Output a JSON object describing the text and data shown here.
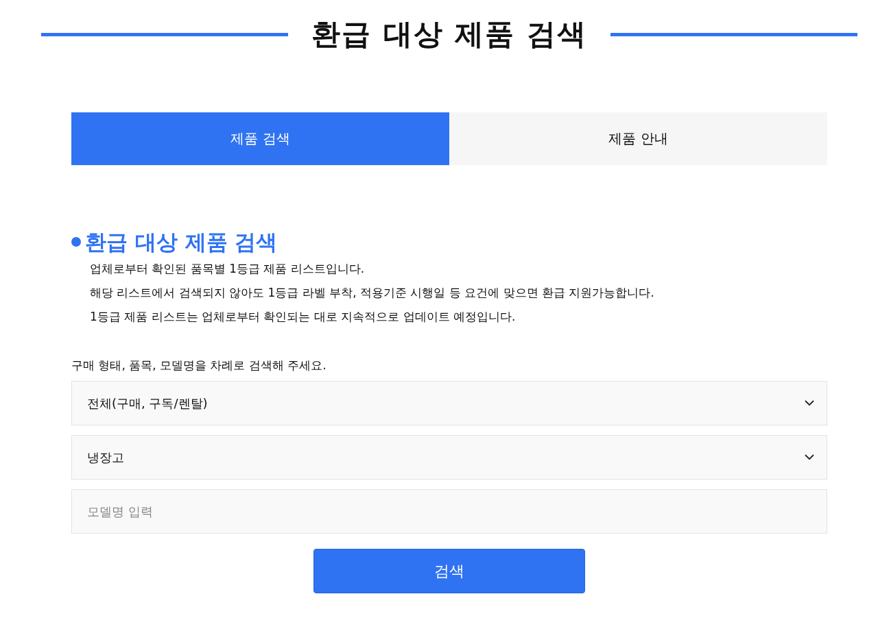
{
  "page_title": "환급 대상 제품 검색",
  "tabs": [
    {
      "label": "제품 검색",
      "selected": true
    },
    {
      "label": "제품 안내",
      "selected": false
    }
  ],
  "section": {
    "heading": "환급 대상 제품 검색",
    "notes": [
      "업체로부터 확인된 품목별 1등급 제품 리스트입니다.",
      "해당 리스트에서 검색되지 않아도 1등급 라벨 부착, 적용기준 시행일 등 요건에 맞으면 환급 지원가능합니다.",
      "1등급 제품 리스트는 업체로부터 확인되는 대로 지속적으로 업데이트 예정입니다."
    ]
  },
  "form": {
    "prompt": "구매 형태, 품목, 모델명을 차례로 검색해 주세요.",
    "fields": [
      {
        "kind": "select",
        "value": "전체(구매, 구독/렌탈)"
      },
      {
        "kind": "select",
        "value": "냉장고"
      },
      {
        "kind": "text",
        "placeholder": "모델명 입력"
      }
    ],
    "submit": "검색"
  }
}
